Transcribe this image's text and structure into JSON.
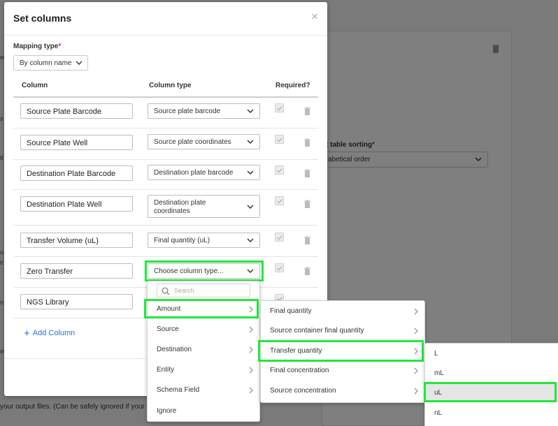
{
  "background": {
    "sort_label": "t table sorting",
    "sort_value": "abetical order",
    "footnote": "your output files. (Can be safely ignored if your",
    "fragments": [
      "er",
      "s",
      "ti",
      "u",
      "ir",
      "n",
      "et"
    ]
  },
  "modal": {
    "title": "Set columns",
    "close_icon": "×",
    "mapping_type_label": "Mapping type",
    "required_marker": "*",
    "mapping_type_value": "By column name",
    "headers": {
      "column": "Column",
      "column_type": "Column type",
      "required": "Required?"
    },
    "rows": [
      {
        "column": "Source Plate Barcode",
        "type": "Source plate barcode",
        "required": true
      },
      {
        "column": "Source Plate Well",
        "type": "Source plate coordinates",
        "required": true
      },
      {
        "column": "Destination Plate Barcode",
        "type": "Destination plate barcode",
        "required": true
      },
      {
        "column": "Destination Plate Well",
        "type": "Destination plate coordinates",
        "required": true
      },
      {
        "column": "Transfer Volume (uL)",
        "type": "Final quantity (uL)",
        "required": true
      },
      {
        "column": "Zero Transfer",
        "type": "Choose column type...",
        "required": true
      },
      {
        "column": "NGS Library",
        "type": "",
        "required": true
      }
    ],
    "add_column": "Add Column"
  },
  "dropdown": {
    "search_placeholder": "Search",
    "level1": [
      "Amount",
      "Source",
      "Destination",
      "Entity",
      "Schema Field",
      "Ignore"
    ],
    "level2": [
      "Final quantity",
      "Source container final quantity",
      "Transfer quantity",
      "Final concentration",
      "Source concentration"
    ],
    "level3": [
      "L",
      "mL",
      "uL",
      "nL"
    ],
    "selected": {
      "level1": "Amount",
      "level2": "Transfer quantity",
      "level3": "uL"
    }
  },
  "colors": {
    "highlight": "#22e83a",
    "link": "#2f6bd8",
    "required": "#c0392b"
  }
}
